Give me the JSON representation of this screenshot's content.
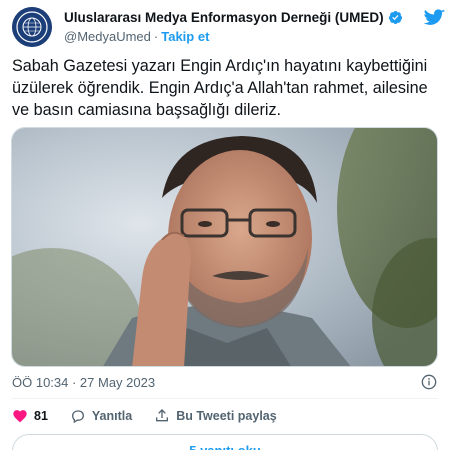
{
  "account": {
    "display_name": "Uluslararası Medya Enformasyon Derneği (UMED)",
    "handle": "@MedyaUmed",
    "separator": "·",
    "follow_label": "Takip et"
  },
  "tweet": {
    "text_lines": [
      "Sabah Gazetesi yazarı Engin Ardıç'ın hayatını kaybettiğini",
      "üzülerek öğrendik. Engin Ardıç'a Allah'tan rahmet, ailesine",
      "ve basın camiasına başsağlığı dileriz."
    ],
    "timestamp": "ÖÖ 10:34 · 27 May 2023"
  },
  "actions": {
    "likes": "81",
    "reply_label": "Yanıtla",
    "share_label": "Bu Tweeti paylaş"
  },
  "replies_button_label": "5 yanıtı oku",
  "colors": {
    "brand_blue": "#1d9bf0",
    "like_red": "#f91880",
    "text_secondary": "#536471"
  },
  "icons": [
    "verified-badge-icon",
    "twitter-bird-icon",
    "info-icon",
    "heart-icon",
    "reply-icon",
    "share-icon"
  ]
}
